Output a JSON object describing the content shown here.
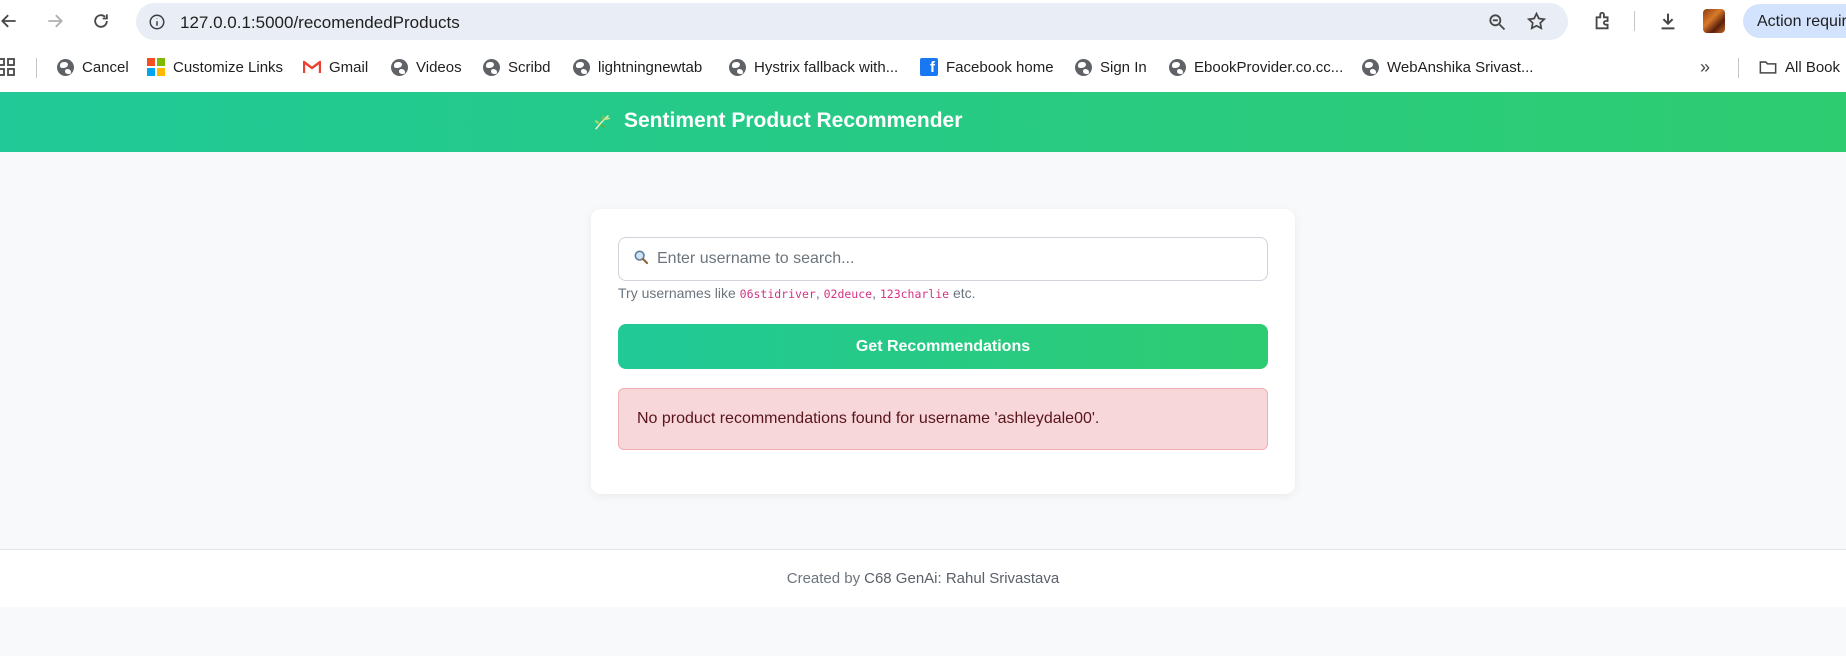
{
  "browser": {
    "url": "127.0.0.1:5000/recomendedProducts",
    "action_pill": "Action require",
    "icons": [
      "back-arrow-icon",
      "forward-arrow-icon",
      "reload-icon",
      "site-info-icon",
      "zoom-icon",
      "star-icon",
      "extensions-icon",
      "download-icon",
      "profile-avatar"
    ]
  },
  "bookmarks": [
    {
      "label": "Cancel",
      "icon": "globe"
    },
    {
      "label": "Customize Links",
      "icon": "microsoft"
    },
    {
      "label": "Gmail",
      "icon": "gmail"
    },
    {
      "label": "Videos",
      "icon": "globe"
    },
    {
      "label": "Scribd",
      "icon": "globe"
    },
    {
      "label": "lightningnewtab",
      "icon": "globe"
    },
    {
      "label": "Hystrix fallback with...",
      "icon": "globe"
    },
    {
      "label": "Facebook home",
      "icon": "facebook"
    },
    {
      "label": "Sign In",
      "icon": "globe"
    },
    {
      "label": "EbookProvider.co.cc...",
      "icon": "globe"
    },
    {
      "label": "WebAnshika Srivast...",
      "icon": "globe"
    }
  ],
  "bookmarks_all_label": "All Book",
  "app": {
    "title": "Sentiment Product Recommender",
    "search_placeholder": "Enter username to search...",
    "hint_prefix": "Try usernames like",
    "hint_examples": [
      "06stidriver",
      "02deuce",
      "123charlie"
    ],
    "hint_sep": ",",
    "hint_suffix": "etc.",
    "button_label": "Get Recommendations",
    "alert_message": "No product recommendations found for username 'ashleydale00'.",
    "footer_prefix": "Created by",
    "footer_author": "C68 GenAi: Rahul Srivastava",
    "colors": {
      "accent_start": "#20c997",
      "accent_end": "#2ecc71",
      "alert_bg": "#f8d7da",
      "alert_text": "#58151c",
      "code_color": "#d63384"
    }
  }
}
